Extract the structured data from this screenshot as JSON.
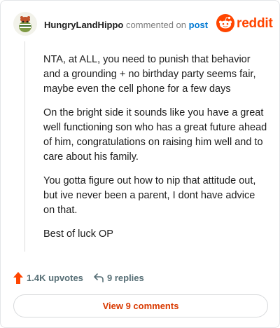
{
  "header": {
    "username": "HungryLandHippo",
    "action_text": "commented on",
    "target_text": "post",
    "brand_name": "reddit",
    "brand_color": "#ff4500",
    "avatar_icon": "hippo-avatar-icon"
  },
  "comment": {
    "paragraphs": [
      "NTA, at ALL, you need to punish that behavior and a grounding + no birthday party seems fair, maybe even the cell phone for a few days",
      "On the bright side it sounds like you have a great well functioning son who has a great future ahead of him, congratulations on raising him well and to care about his family.",
      "You gotta figure out how to nip that attitude out, but ive never been a parent, I dont have advice on that.",
      "Best of luck OP"
    ]
  },
  "actions": {
    "upvotes_label": "1.4K upvotes",
    "replies_label": "9 replies",
    "upvote_icon": "upvote-arrow-icon",
    "reply_icon": "reply-arrow-icon",
    "upvote_color": "#ff4500"
  },
  "footer": {
    "view_comments_label": "View 9 comments",
    "link_color": "#d93900"
  }
}
